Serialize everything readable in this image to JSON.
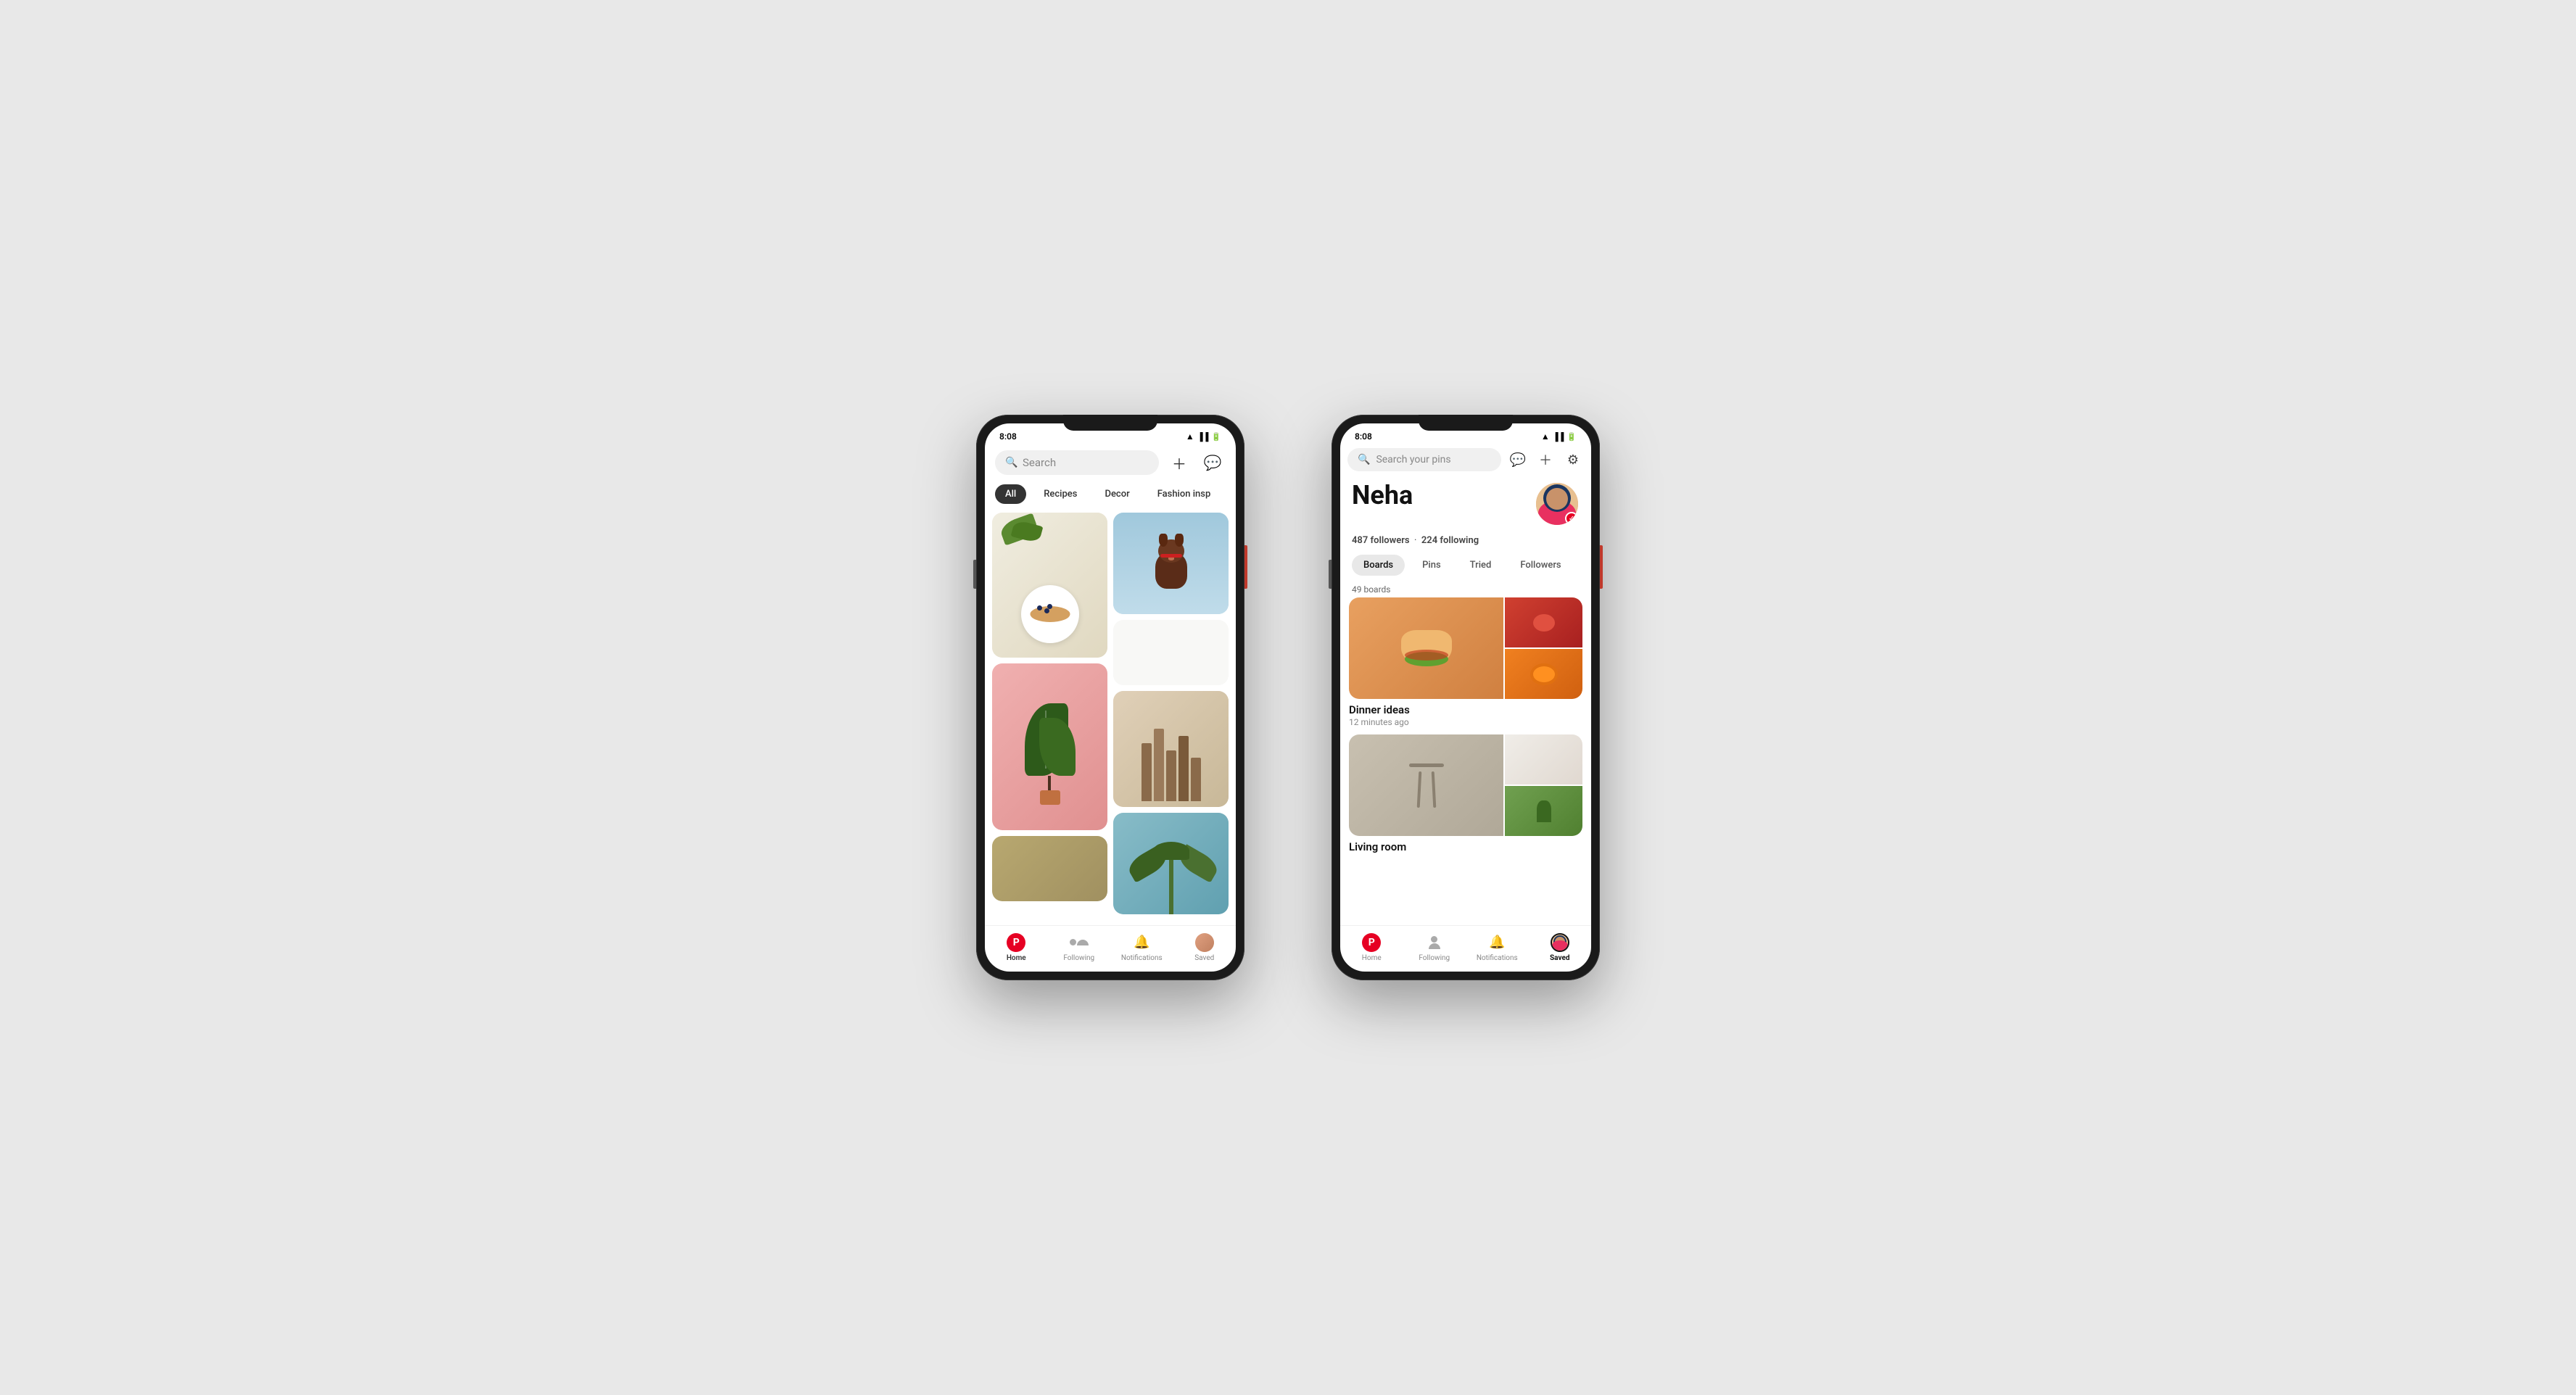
{
  "page": {
    "background": "#e8e8e8"
  },
  "phone1": {
    "status_time": "8:08",
    "search_placeholder": "Search",
    "categories": [
      {
        "label": "All",
        "active": true
      },
      {
        "label": "Recipes",
        "active": false
      },
      {
        "label": "Decor",
        "active": false
      },
      {
        "label": "Fashion insp",
        "active": false
      }
    ],
    "nav": {
      "home": "Home",
      "following": "Following",
      "notifications": "Notifications",
      "saved": "Saved"
    }
  },
  "phone2": {
    "status_time": "8:08",
    "search_placeholder": "Search your pins",
    "profile": {
      "name": "Neha",
      "followers_count": "487",
      "followers_label": "followers",
      "following_count": "224",
      "following_label": "following"
    },
    "tabs": [
      {
        "label": "Boards",
        "active": true
      },
      {
        "label": "Pins",
        "active": false
      },
      {
        "label": "Tried",
        "active": false
      },
      {
        "label": "Followers",
        "active": false
      }
    ],
    "boards_count": "49 boards",
    "boards": [
      {
        "title": "Dinner ideas",
        "time": "12 minutes ago"
      },
      {
        "title": "Living room",
        "time": ""
      }
    ],
    "nav": {
      "home": "Home",
      "following": "Following",
      "notifications": "Notifications",
      "saved": "Saved"
    }
  }
}
